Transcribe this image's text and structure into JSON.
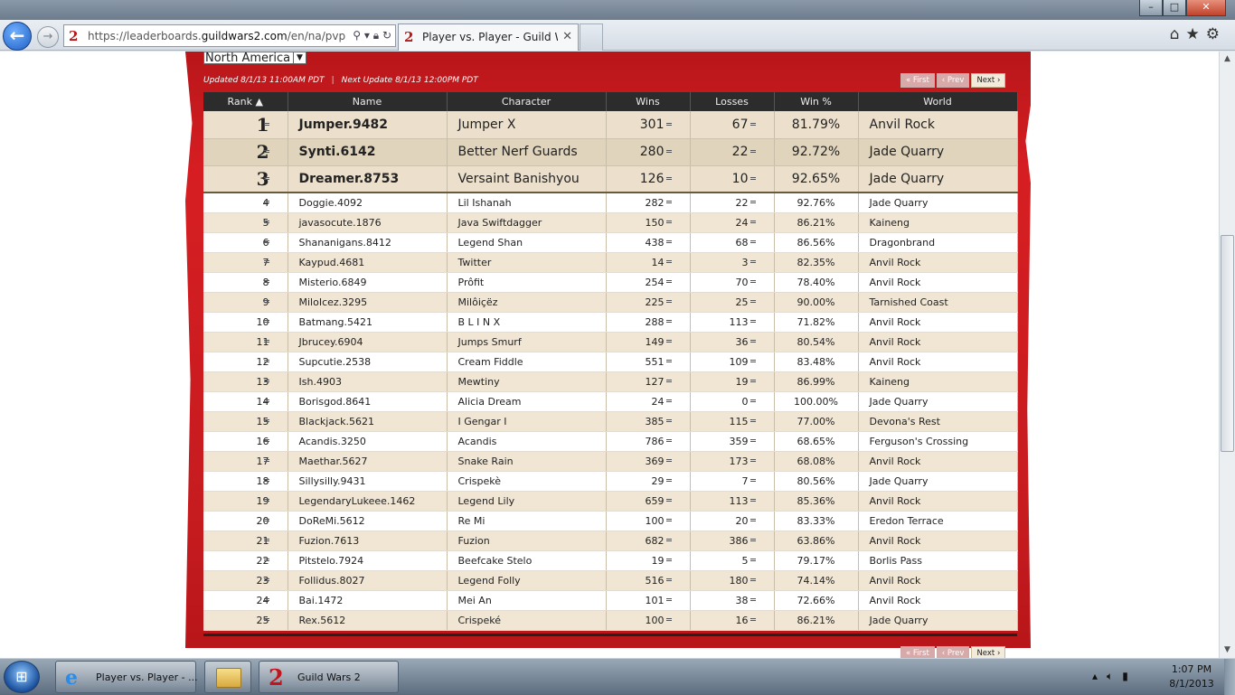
{
  "browser": {
    "url_prefix": "https://leaderboards.",
    "url_domain": "guildwars2.com",
    "url_path": "/en/na/pvp",
    "tab_title": "Player vs. Player - Guild Wa...",
    "favicon": "2"
  },
  "page": {
    "region": "North America",
    "updated": "Updated 8/1/13 11:00AM PDT",
    "next_update": "Next Update 8/1/13 12:00PM PDT",
    "pager": {
      "first": "« First",
      "prev": "‹ Prev",
      "next": "Next ›"
    }
  },
  "table": {
    "headers": [
      "Rank ▲",
      "Name",
      "Character",
      "Wins",
      "Losses",
      "Win %",
      "World"
    ],
    "rows": [
      {
        "rank": "1",
        "name": "Jumper.9482",
        "character": "Jumper X",
        "wins": "301",
        "losses": "67",
        "pct": "81.79%",
        "world": "Anvil Rock"
      },
      {
        "rank": "2",
        "name": "Synti.6142",
        "character": "Better Nerf Guards",
        "wins": "280",
        "losses": "22",
        "pct": "92.72%",
        "world": "Jade Quarry"
      },
      {
        "rank": "3",
        "name": "Dreamer.8753",
        "character": "Versaint Banishyou",
        "wins": "126",
        "losses": "10",
        "pct": "92.65%",
        "world": "Jade Quarry"
      },
      {
        "rank": "4",
        "name": "Doggie.4092",
        "character": "Lil Ishanah",
        "wins": "282",
        "losses": "22",
        "pct": "92.76%",
        "world": "Jade Quarry"
      },
      {
        "rank": "5",
        "name": "javasocute.1876",
        "character": "Java Swiftdagger",
        "wins": "150",
        "losses": "24",
        "pct": "86.21%",
        "world": "Kaineng"
      },
      {
        "rank": "6",
        "name": "Shananigans.8412",
        "character": "Legend Shan",
        "wins": "438",
        "losses": "68",
        "pct": "86.56%",
        "world": "Dragonbrand"
      },
      {
        "rank": "7",
        "name": "Kaypud.4681",
        "character": "Twitter",
        "wins": "14",
        "losses": "3",
        "pct": "82.35%",
        "world": "Anvil Rock"
      },
      {
        "rank": "8",
        "name": "Misterio.6849",
        "character": "Prôfit",
        "wins": "254",
        "losses": "70",
        "pct": "78.40%",
        "world": "Anvil Rock"
      },
      {
        "rank": "9",
        "name": "MiloIcez.3295",
        "character": "Milôiçëz",
        "wins": "225",
        "losses": "25",
        "pct": "90.00%",
        "world": "Tarnished Coast"
      },
      {
        "rank": "10",
        "name": "Batmang.5421",
        "character": "B L I N X",
        "wins": "288",
        "losses": "113",
        "pct": "71.82%",
        "world": "Anvil Rock"
      },
      {
        "rank": "11",
        "name": "Jbrucey.6904",
        "character": "Jumps Smurf",
        "wins": "149",
        "losses": "36",
        "pct": "80.54%",
        "world": "Anvil Rock"
      },
      {
        "rank": "12",
        "name": "Supcutie.2538",
        "character": "Cream Fiddle",
        "wins": "551",
        "losses": "109",
        "pct": "83.48%",
        "world": "Anvil Rock"
      },
      {
        "rank": "13",
        "name": "Ish.4903",
        "character": "Mewtiny",
        "wins": "127",
        "losses": "19",
        "pct": "86.99%",
        "world": "Kaineng"
      },
      {
        "rank": "14",
        "name": "Borisgod.8641",
        "character": "Alicia Dream",
        "wins": "24",
        "losses": "0",
        "pct": "100.00%",
        "world": "Jade Quarry"
      },
      {
        "rank": "15",
        "name": "Blackjack.5621",
        "character": "I Gengar I",
        "wins": "385",
        "losses": "115",
        "pct": "77.00%",
        "world": "Devona's Rest"
      },
      {
        "rank": "16",
        "name": "Acandis.3250",
        "character": "Acandis",
        "wins": "786",
        "losses": "359",
        "pct": "68.65%",
        "world": "Ferguson's Crossing"
      },
      {
        "rank": "17",
        "name": "Maethar.5627",
        "character": "Snake Rain",
        "wins": "369",
        "losses": "173",
        "pct": "68.08%",
        "world": "Anvil Rock"
      },
      {
        "rank": "18",
        "name": "Sillysilly.9431",
        "character": "Crispekè",
        "wins": "29",
        "losses": "7",
        "pct": "80.56%",
        "world": "Jade Quarry"
      },
      {
        "rank": "19",
        "name": "LegendaryLukeee.1462",
        "character": "Legend Lily",
        "wins": "659",
        "losses": "113",
        "pct": "85.36%",
        "world": "Anvil Rock"
      },
      {
        "rank": "20",
        "name": "DoReMi.5612",
        "character": "Re Mi",
        "wins": "100",
        "losses": "20",
        "pct": "83.33%",
        "world": "Eredon Terrace"
      },
      {
        "rank": "21",
        "name": "Fuzion.7613",
        "character": "Fuzion",
        "wins": "682",
        "losses": "386",
        "pct": "63.86%",
        "world": "Anvil Rock"
      },
      {
        "rank": "22",
        "name": "Pitstelo.7924",
        "character": "Beefcake Stelo",
        "wins": "19",
        "losses": "5",
        "pct": "79.17%",
        "world": "Borlis Pass"
      },
      {
        "rank": "23",
        "name": "Follidus.8027",
        "character": "Legend Folly",
        "wins": "516",
        "losses": "180",
        "pct": "74.14%",
        "world": "Anvil Rock"
      },
      {
        "rank": "24",
        "name": "Bai.1472",
        "character": "Mei An",
        "wins": "101",
        "losses": "38",
        "pct": "72.66%",
        "world": "Anvil Rock"
      },
      {
        "rank": "25",
        "name": "Rex.5612",
        "character": "Crispeké",
        "wins": "100",
        "losses": "16",
        "pct": "86.21%",
        "world": "Jade Quarry"
      }
    ]
  },
  "taskbar": {
    "ie_label": "Player vs. Player - ...",
    "gw2_label": "Guild Wars 2",
    "time": "1:07 PM",
    "date": "8/1/2013"
  },
  "colors": {
    "banner_red": "#c51b1f",
    "row_tan": "#f1e6d4",
    "header_dark": "#2c2c2c"
  }
}
